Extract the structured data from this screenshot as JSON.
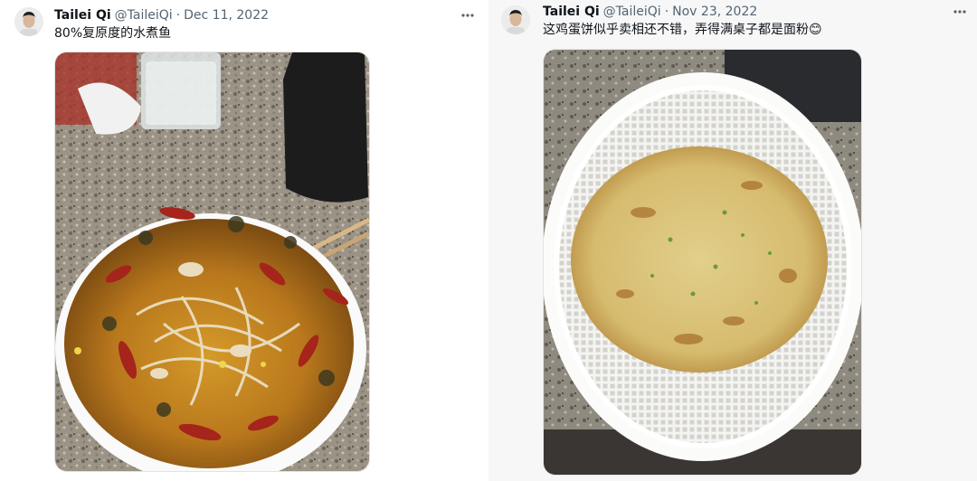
{
  "tweets": [
    {
      "display_name": "Tailei Qi",
      "handle": "@TaileiQi",
      "separator": "·",
      "date": "Dec 11, 2022",
      "text": "80%复原度的水煮鱼",
      "more_icon": "more-horizontal-icon",
      "media_subject": "fish-in-chili-oil-photo"
    },
    {
      "display_name": "Tailei Qi",
      "handle": "@TaileiQi",
      "separator": "·",
      "date": "Nov 23, 2022",
      "text": "这鸡蛋饼似乎卖相还不错，弄得满桌子都是面粉😊",
      "more_icon": "more-horizontal-icon",
      "media_subject": "egg-pancake-in-colander-photo"
    }
  ],
  "colors": {
    "name": "#0f1419",
    "secondary": "#536471",
    "right_panel_bg": "#f7f7f8"
  }
}
